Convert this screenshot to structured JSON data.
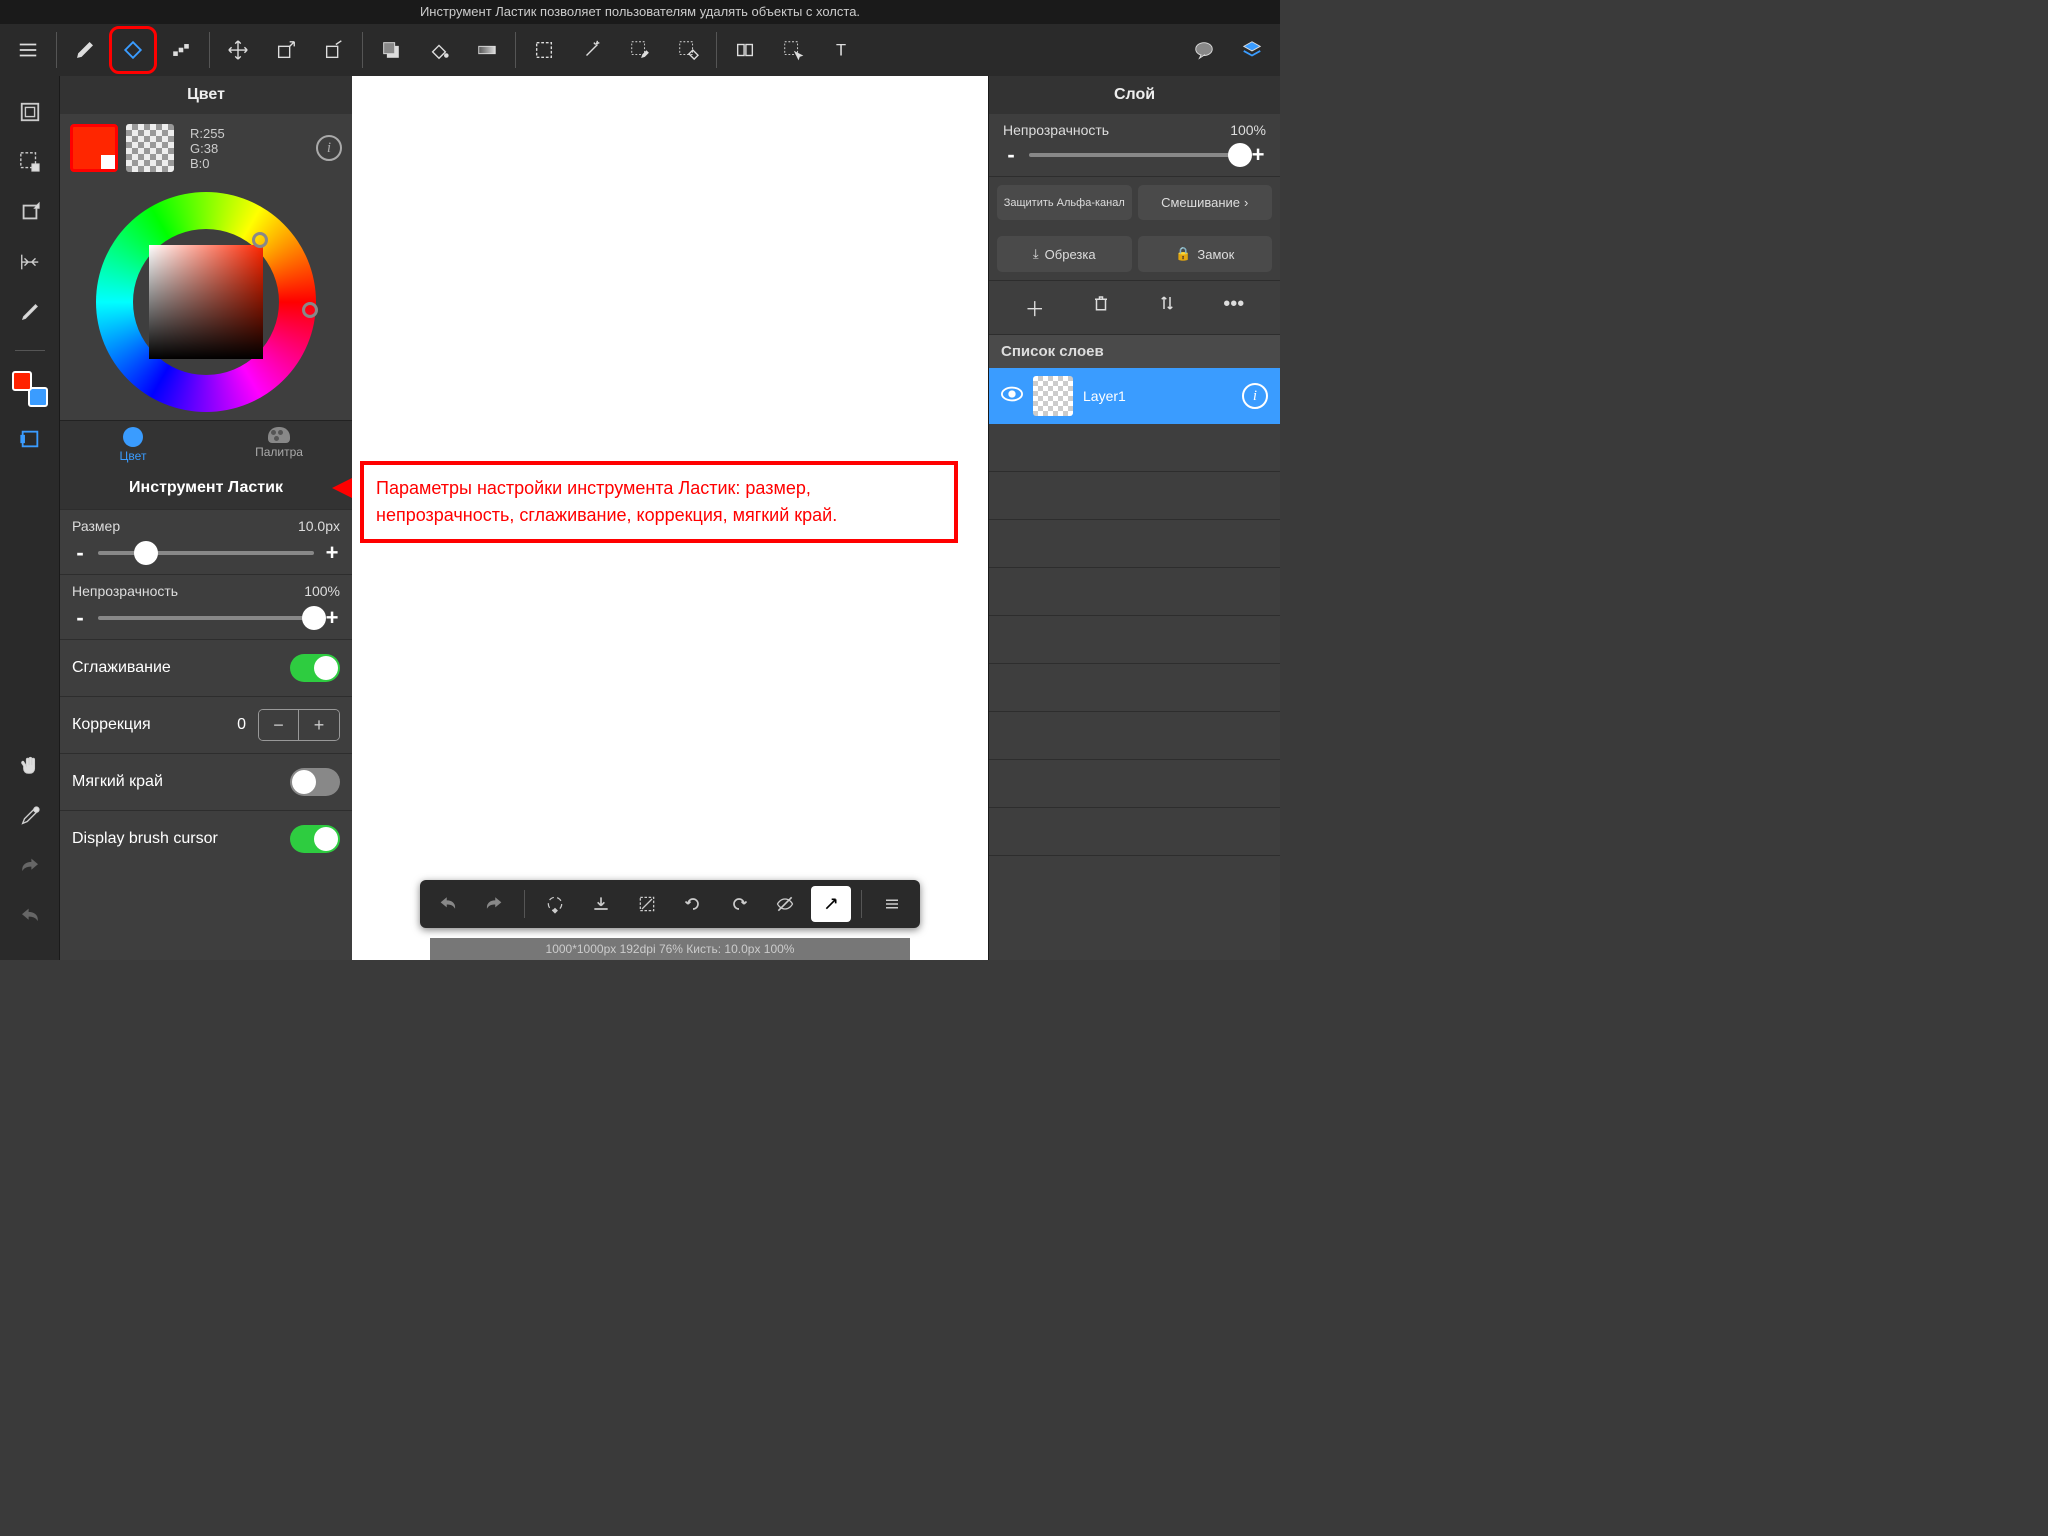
{
  "title": "Инструмент Ластик позволяет пользователям удалять объекты с холста.",
  "color_panel": {
    "header": "Цвет",
    "rgb": "R:255\nG:38\nB:0",
    "tabs": {
      "color": "Цвет",
      "palette": "Палитра"
    }
  },
  "tool_panel": {
    "name": "Инструмент Ластик",
    "size_label": "Размер",
    "size_value": "10.0px",
    "size_pct": 22,
    "opacity_label": "Непрозрачность",
    "opacity_value": "100%",
    "opacity_pct": 100,
    "antialias_label": "Сглаживание",
    "correction_label": "Коррекция",
    "correction_value": "0",
    "soft_edge_label": "Мягкий край",
    "cursor_label": "Display brush cursor"
  },
  "annotation": "Параметры настройки инструмента Ластик: размер, непрозрачность, сглаживание, коррекция, мягкий край.",
  "status": "1000*1000px 192dpi 76% Кисть: 10.0px 100%",
  "layer_panel": {
    "header": "Слой",
    "opacity_label": "Непрозрачность",
    "opacity_value": "100%",
    "opacity_pct": 100,
    "protect_alpha": "Защитить Альфа-канал",
    "blend": "Смешивание",
    "crop": "Обрезка",
    "lock": "Замок",
    "list_header": "Список слоев",
    "layer1_name": "Layer1"
  }
}
